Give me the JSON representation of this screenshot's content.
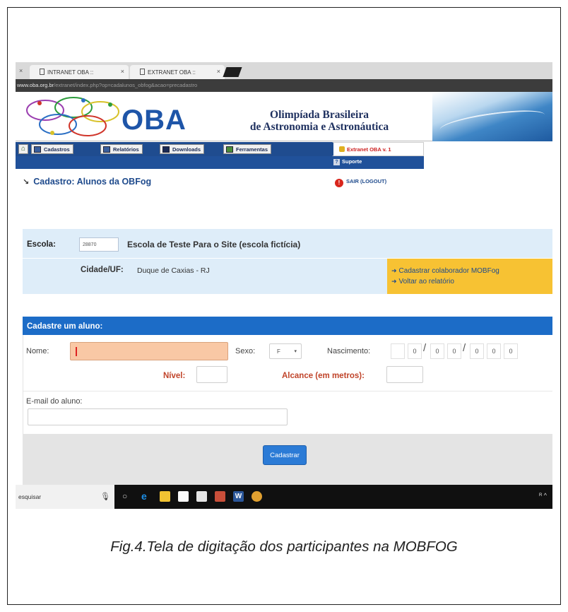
{
  "browser": {
    "tabs": [
      {
        "label": "INTRANET OBA ::"
      },
      {
        "label": "EXTRANET OBA ::"
      }
    ],
    "url_host": "www.oba.org.br",
    "url_path": "/extranet/index.php?op=cadalunos_obfog&acao=precadastro"
  },
  "header": {
    "logo_text": "OBA",
    "title_line1": "Olimpíada Brasileira",
    "title_line2": "de Astronomia e Astronáutica"
  },
  "menu": {
    "items": [
      {
        "label": "Cadastros"
      },
      {
        "label": "Relatórios"
      },
      {
        "label": "Downloads"
      },
      {
        "label": "Ferramentas"
      }
    ],
    "extranet_label": "Extranet OBA v. 1",
    "suporte_label": "Suporte"
  },
  "page": {
    "title": "Cadastro: Alunos da OBFog",
    "logout_label": "SAIR (LOGOUT)"
  },
  "escola": {
    "label": "Escola:",
    "code": "28870",
    "name": "Escola de Teste Para o Site (escola fictícia)",
    "cidade_label": "Cidade/UF:",
    "cidade_value": "Duque de Caxias  -  RJ"
  },
  "side_links": [
    {
      "label": "Cadastrar colaborador MOBFog"
    },
    {
      "label": "Voltar ao relatório"
    }
  ],
  "form": {
    "header": "Cadastre um aluno:",
    "nome_label": "Nome:",
    "nome_value": "",
    "sexo_label": "Sexo:",
    "sexo_value": "F",
    "nascimento_label": "Nascimento:",
    "nascimento_digits": [
      "0",
      "0",
      "0",
      "0",
      "0",
      "0"
    ],
    "date_separator": "/",
    "nivel_label": "Nível:",
    "alcance_label": "Alcance (em metros):",
    "email_label": "E-mail do aluno:",
    "submit_label": "Cadastrar"
  },
  "taskbar": {
    "search_text": "esquisar",
    "tray_text": "ᴿ ^"
  },
  "caption": "Fig.4.Tela de digitação dos participantes na MOBFOG",
  "colors": {
    "brand_blue": "#1e55a8",
    "menu_blue": "#1f4c8f",
    "form_header_blue": "#1c6cc7",
    "side_links_yellow": "#f7c233",
    "field_highlight": "#f9c8a5",
    "label_red": "#c0442a"
  }
}
